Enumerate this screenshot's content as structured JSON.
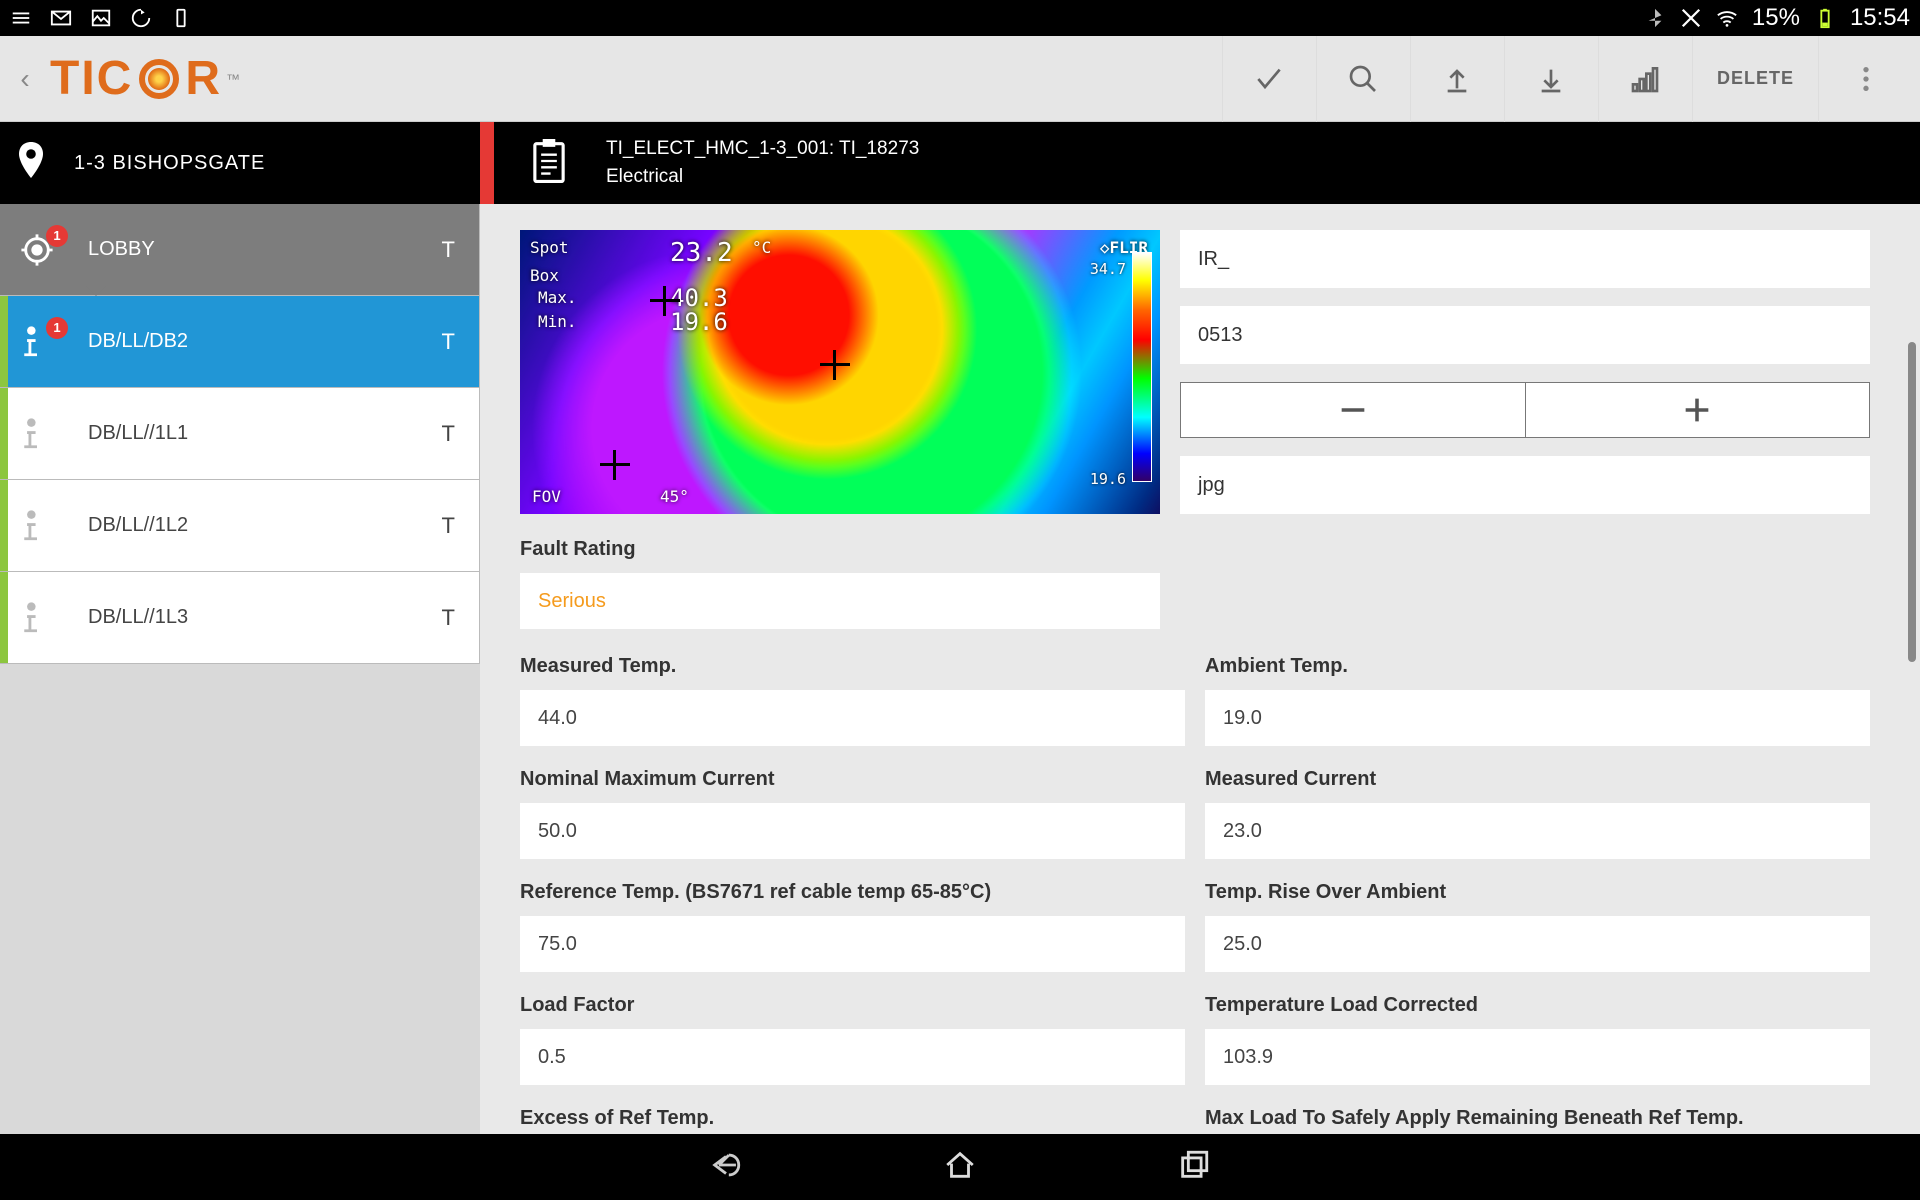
{
  "status": {
    "battery": "15%",
    "time": "15:54"
  },
  "header": {
    "delete_label": "DELETE"
  },
  "location": {
    "title": "1-3 BISHOPSGATE"
  },
  "sidebar": {
    "items": [
      {
        "label": "LOBBY",
        "badge": "1",
        "t": "T"
      },
      {
        "label": "DB/LL/DB2",
        "badge": "1",
        "t": "T"
      },
      {
        "label": "DB/LL//1L1",
        "badge": "",
        "t": "T"
      },
      {
        "label": "DB/LL//1L2",
        "badge": "",
        "t": "T"
      },
      {
        "label": "DB/LL//1L3",
        "badge": "",
        "t": "T"
      }
    ]
  },
  "record": {
    "title": "TI_ELECT_HMC_1-3_001: TI_18273",
    "category": "Electrical"
  },
  "image_fields": {
    "prefix": "IR_",
    "number": "0513",
    "ext": "jpg"
  },
  "thermal": {
    "spot_label": "Spot",
    "box_label": "Box",
    "max_label": "Max.",
    "min_label": "Min.",
    "fov_label": "FOV",
    "spot": "23.2",
    "unit": "°C",
    "max": "40.3",
    "min": "19.6",
    "fov": "45°",
    "brand": "◇FLIR",
    "scale_hi": "34.7",
    "scale_lo": "19.6"
  },
  "form": {
    "fault_rating_label": "Fault Rating",
    "fault_rating": "Serious",
    "measured_temp_label": "Measured Temp.",
    "measured_temp": "44.0",
    "ambient_temp_label": "Ambient Temp.",
    "ambient_temp": "19.0",
    "nominal_max_current_label": "Nominal Maximum Current",
    "nominal_max_current": "50.0",
    "measured_current_label": "Measured Current",
    "measured_current": "23.0",
    "reference_temp_label": "Reference Temp. (BS7671 ref cable temp 65-85°C)",
    "reference_temp": "75.0",
    "temp_rise_label": "Temp. Rise Over Ambient",
    "temp_rise": "25.0",
    "load_factor_label": "Load Factor",
    "load_factor": "0.5",
    "temp_load_corrected_label": "Temperature Load Corrected",
    "temp_load_corrected": "103.9",
    "excess_ref_label": "Excess of Ref Temp.",
    "max_load_safe_label": "Max Load To Safely Apply Remaining Beneath Ref Temp."
  }
}
